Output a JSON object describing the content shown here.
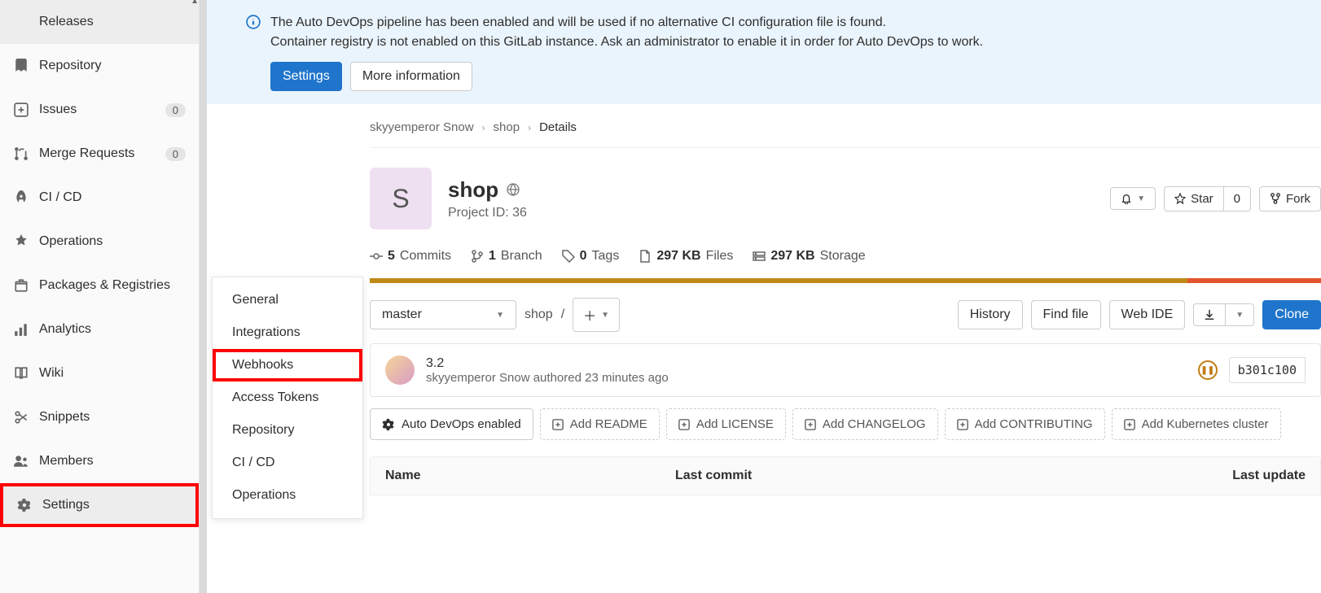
{
  "sidebar": {
    "items": [
      {
        "label": "Releases",
        "indent": true
      },
      {
        "label": "Repository"
      },
      {
        "label": "Issues",
        "badge": "0"
      },
      {
        "label": "Merge Requests",
        "badge": "0"
      },
      {
        "label": "CI / CD"
      },
      {
        "label": "Operations"
      },
      {
        "label": "Packages & Registries"
      },
      {
        "label": "Analytics"
      },
      {
        "label": "Wiki"
      },
      {
        "label": "Snippets"
      },
      {
        "label": "Members"
      },
      {
        "label": "Settings"
      }
    ]
  },
  "submenu": {
    "items": [
      "General",
      "Integrations",
      "Webhooks",
      "Access Tokens",
      "Repository",
      "CI / CD",
      "Operations"
    ]
  },
  "alert": {
    "line1": "The Auto DevOps pipeline has been enabled and will be used if no alternative CI configuration file is found.",
    "line2": "Container registry is not enabled on this GitLab instance. Ask an administrator to enable it in order for Auto DevOps to work.",
    "settings_btn": "Settings",
    "more_info_btn": "More information"
  },
  "breadcrumb": {
    "owner": "skyyemperor Snow",
    "project": "shop",
    "current": "Details"
  },
  "project": {
    "avatar_letter": "S",
    "name": "shop",
    "id_label": "Project ID: 36",
    "star_label": "Star",
    "star_count": "0",
    "fork_label": "Fork"
  },
  "stats": {
    "commits_n": "5",
    "commits": "Commits",
    "branches_n": "1",
    "branches": "Branch",
    "tags_n": "0",
    "tags": "Tags",
    "files_n": "297 KB",
    "files": "Files",
    "storage_n": "297 KB",
    "storage": "Storage"
  },
  "branch": {
    "selected": "master",
    "path": "shop",
    "path_sep": "/",
    "history_btn": "History",
    "find_file_btn": "Find file",
    "webide_btn": "Web IDE",
    "clone_btn": "Clone"
  },
  "commit": {
    "title": "3.2",
    "author": "skyyemperor Snow",
    "action": "authored",
    "time": "23 minutes ago",
    "sha": "b301c100"
  },
  "add_buttons": {
    "autodevops": "Auto DevOps enabled",
    "readme": "Add README",
    "license": "Add LICENSE",
    "changelog": "Add CHANGELOG",
    "contributing": "Add CONTRIBUTING",
    "kubernetes": "Add Kubernetes cluster"
  },
  "file_table": {
    "name": "Name",
    "last_commit": "Last commit",
    "last_update": "Last update"
  }
}
